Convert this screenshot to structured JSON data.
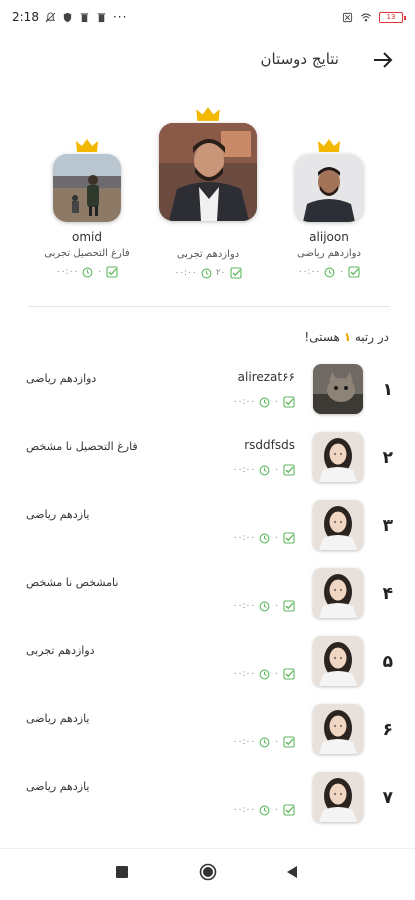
{
  "status_bar": {
    "time": "2:18",
    "battery": "13"
  },
  "header": {
    "title": "نتایج دوستان"
  },
  "podium": [
    {
      "name": "omid",
      "grade": "فارغ التحصیل تجربی",
      "correct": "۰",
      "time": "۰۰:۰۰"
    },
    {
      "name": "",
      "grade": "دوازدهم تجربی",
      "correct": "۲۰",
      "time": "۰۰:۰۰"
    },
    {
      "name": "alijoon",
      "grade": "دوازدهم ریاضی",
      "correct": "۰",
      "time": "۰۰:۰۰"
    }
  ],
  "rank_text": {
    "prefix": "در رتبه",
    "number": "۱",
    "suffix": "هستی!"
  },
  "list": [
    {
      "rank": "۱",
      "username": "alirezat۶۶",
      "grade": "دوازدهم ریاضی",
      "correct": "۰",
      "time": "۰۰:۰۰"
    },
    {
      "rank": "۲",
      "username": "rsddfsds",
      "grade": "فارغ التحصیل نا مشخص",
      "correct": "۰",
      "time": "۰۰:۰۰"
    },
    {
      "rank": "۳",
      "username": "",
      "grade": "یازدهم ریاضی",
      "correct": "۰",
      "time": "۰۰:۰۰"
    },
    {
      "rank": "۴",
      "username": "",
      "grade": "نامشخص نا مشخص",
      "correct": "۰",
      "time": "۰۰:۰۰"
    },
    {
      "rank": "۵",
      "username": "",
      "grade": "دوازدهم تجربی",
      "correct": "۰",
      "time": "۰۰:۰۰"
    },
    {
      "rank": "۶",
      "username": "",
      "grade": "یازدهم ریاضی",
      "correct": "۰",
      "time": "۰۰:۰۰"
    },
    {
      "rank": "۷",
      "username": "",
      "grade": "یازدهم ریاضی",
      "correct": "۰",
      "time": "۰۰:۰۰"
    }
  ],
  "colors": {
    "accent": "#f0a500",
    "check": "#5cb85c",
    "crown": "#f5b800"
  }
}
